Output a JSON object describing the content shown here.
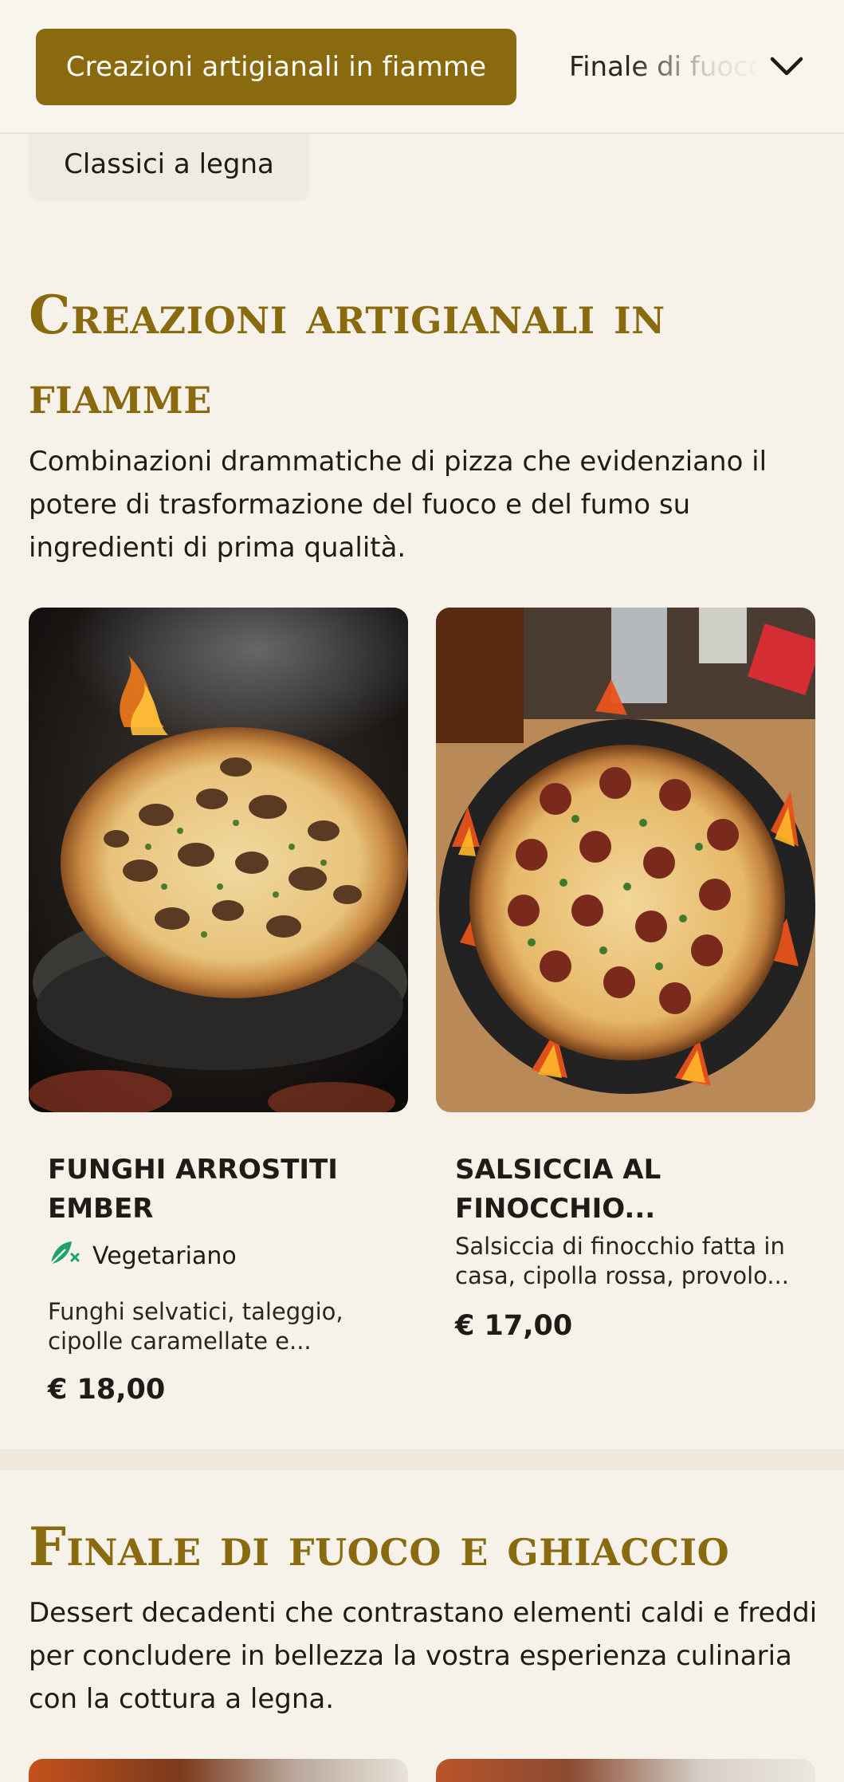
{
  "topbar": {
    "active_category": "Creazioni artigianali in fiamme",
    "next_category": "Finale di fuoco",
    "secondary_category": "Classici a legna",
    "dropdown_icon": "chevron-down-icon"
  },
  "sections": [
    {
      "title": "Creazioni artigianali in fiamme",
      "description": "Combinazioni drammatiche di pizza che evidenziano il potere di trasformazione del fuoco e del fumo su ingredienti di prima qualità.",
      "items": [
        {
          "name": "FUNGHI ARROSTITI EMBER",
          "badge": "Vegetariano",
          "badge_icon": "leaf-icon",
          "description": "Funghi selvatici, taleggio, cipolle caramellate e...",
          "price": "€ 18,00"
        },
        {
          "name": "SALSICCIA AL FINOCCHIO...",
          "description": "Salsiccia di finocchio fatta in casa, cipolla rossa, provolo...",
          "price": "€ 17,00"
        }
      ]
    },
    {
      "title": "Finale di fuoco e ghiaccio",
      "description": "Dessert decadenti che contrastano elementi caldi e freddi per concludere in bellezza la vostra esperienza culinaria con la cottura a legna."
    }
  ],
  "colors": {
    "accent": "#8a6a0f",
    "background": "#f6f2ea",
    "veg_green": "#1aa36b"
  }
}
